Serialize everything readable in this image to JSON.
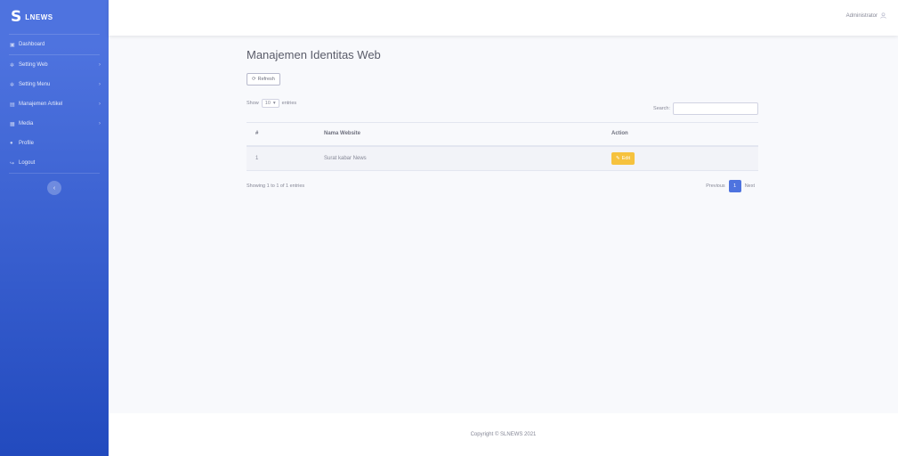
{
  "brand": {
    "mark": "S",
    "name": "LNEWS"
  },
  "sidebar": {
    "items": [
      {
        "icon": "dashboard-icon",
        "label": "Dashboard",
        "chevron": false
      },
      {
        "icon": "gear-icon",
        "label": "Setting Web",
        "chevron": true
      },
      {
        "icon": "gear-icon",
        "label": "Setting Menu",
        "chevron": true
      },
      {
        "icon": "folder-icon",
        "label": "Manajemen Artikel",
        "chevron": true
      },
      {
        "icon": "image-icon",
        "label": "Media",
        "chevron": true
      },
      {
        "icon": "user-icon",
        "label": "Profile",
        "chevron": false
      },
      {
        "icon": "logout-icon",
        "label": "Logout",
        "chevron": false
      }
    ],
    "toggle_glyph": "‹"
  },
  "topbar": {
    "username": "Administrator"
  },
  "page": {
    "title": "Manajemen Identitas Web",
    "refresh_label": "Refresh",
    "show_label": "Show",
    "entries_value": "10",
    "entries_label": "entries",
    "search_label": "Search:",
    "search_value": ""
  },
  "table": {
    "headers": [
      "#",
      "Nama Website",
      "Action"
    ],
    "rows": [
      {
        "no": "1",
        "name": "Surat kabar News",
        "action": "Edit"
      }
    ]
  },
  "pagination": {
    "info": "Showing 1 to 1 of 1 entries",
    "previous": "Previous",
    "current": "1",
    "next": "Next"
  },
  "footer": {
    "text": "Copyright © SLNEWS 2021"
  },
  "colors": {
    "sidebar_top": "#4e73df",
    "sidebar_bottom": "#224abe",
    "edit_button": "#f6c23e",
    "page_active": "#4e73df"
  }
}
